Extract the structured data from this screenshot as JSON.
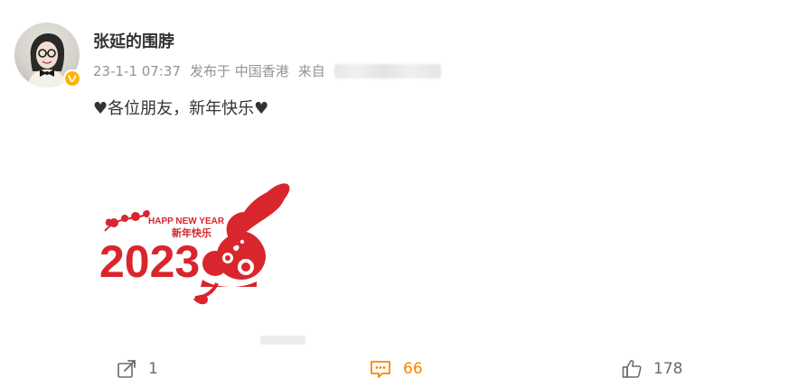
{
  "post": {
    "username": "张延的围脖",
    "timestamp": "23-1-1 07:37",
    "location": "发布于 中国香港",
    "source_prefix": "来自",
    "text": "♥各位朋友，新年快乐♥"
  },
  "image": {
    "greeting_en": "HAPP NEW YEAR",
    "greeting_cn": "新年快乐",
    "year": "2023"
  },
  "actions": {
    "share_count": "1",
    "comment_count": "66",
    "like_count": "178"
  },
  "colors": {
    "accent": "#ff8200",
    "papercut_red": "#d8262c",
    "verified": "#ffb400",
    "muted": "#939393"
  }
}
